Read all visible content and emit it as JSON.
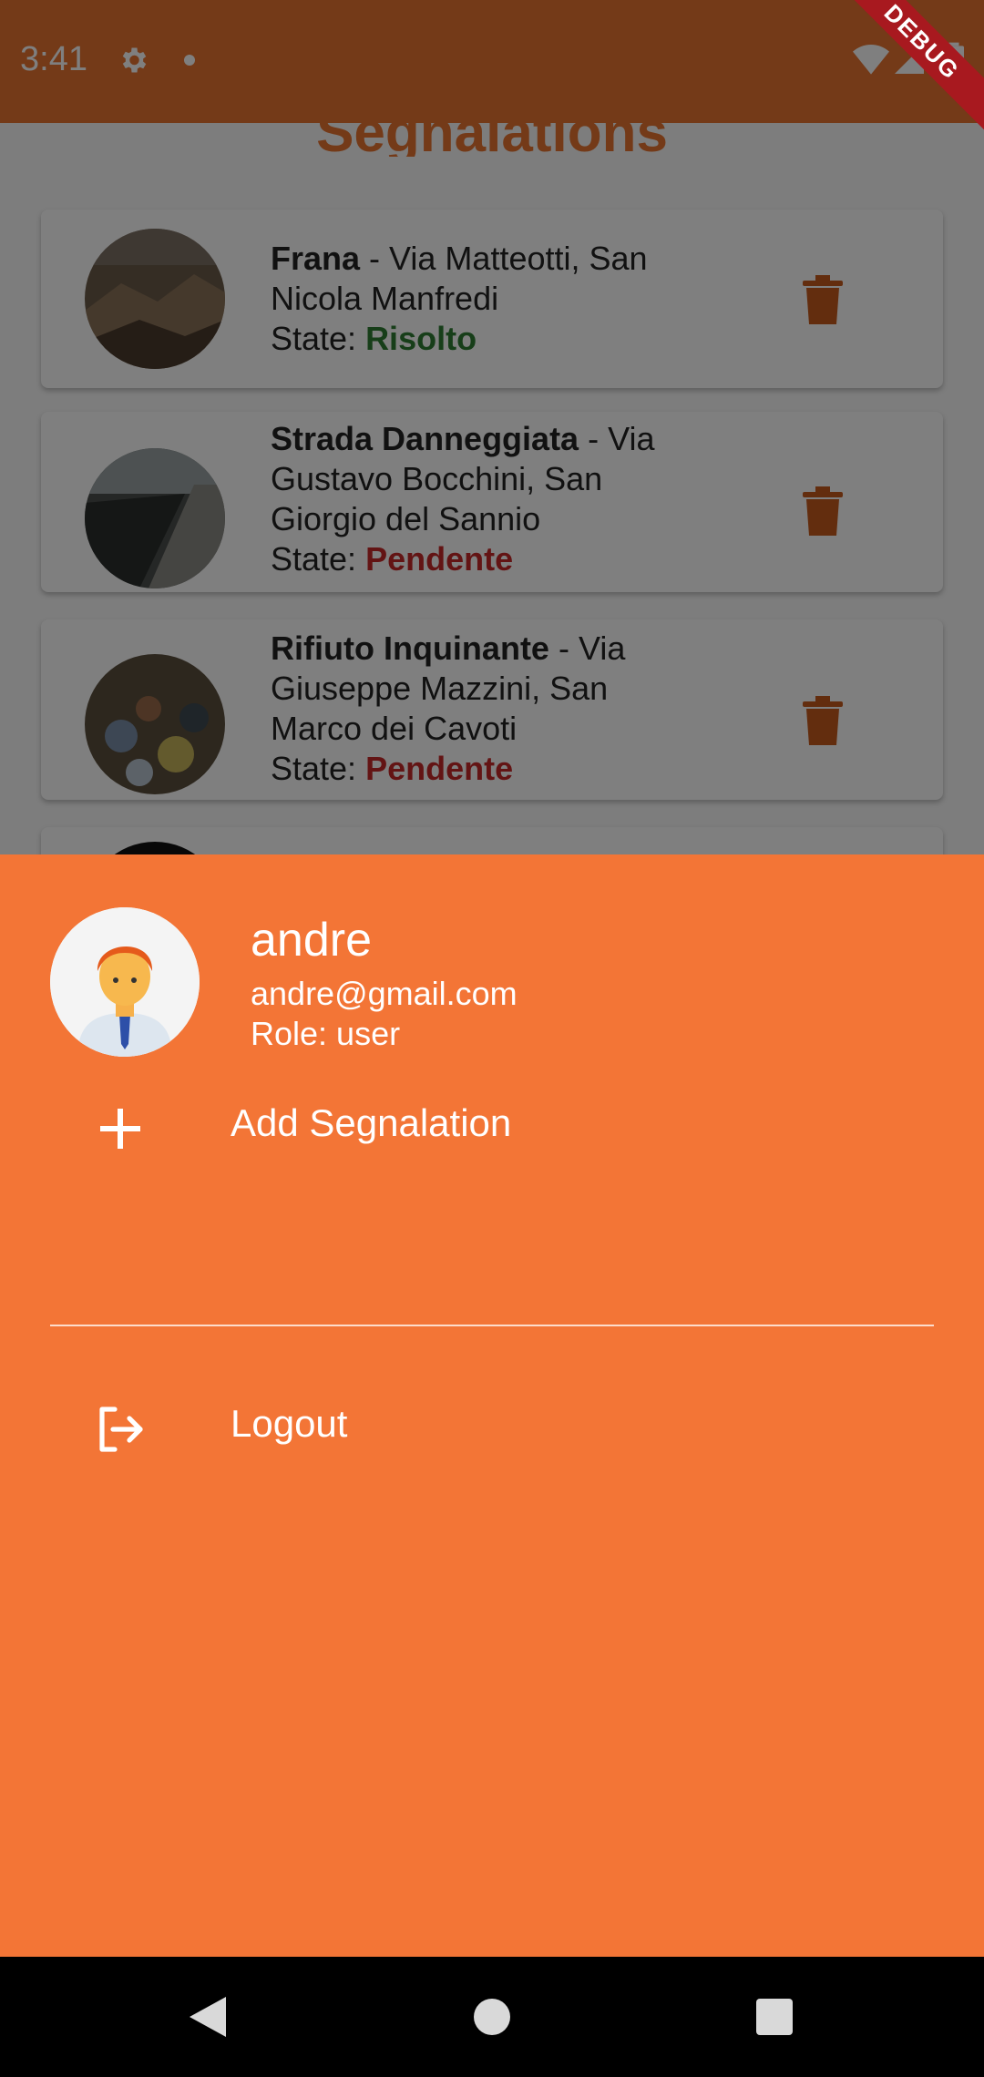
{
  "status_bar": {
    "time": "3:41"
  },
  "debug_banner": "DEBUG",
  "app": {
    "title": "Segnalations"
  },
  "segnalations": [
    {
      "type": "Frana",
      "sep": " - ",
      "address": "Via Matteotti, San Nicola Manfredi",
      "state_label": "State: ",
      "state": "Risolto",
      "state_color": "#2e7d32"
    },
    {
      "type": "Strada Danneggiata",
      "sep": " - ",
      "address": "Via Gustavo Bocchini, San Giorgio del Sannio",
      "state_label": "State: ",
      "state": "Pendente",
      "state_color": "#c62828"
    },
    {
      "type": "Rifiuto Inquinante",
      "sep": " - ",
      "address": "Via Giuseppe Mazzini, San Marco dei Cavoti",
      "state_label": "State: ",
      "state": "Pendente",
      "state_color": "#c62828"
    }
  ],
  "drawer": {
    "user": {
      "name": "andre",
      "email": "andre@gmail.com",
      "role": "Role: user"
    },
    "menu": [
      {
        "label": "Add Segnalation",
        "icon": "plus-icon"
      },
      {
        "label": "Logout",
        "icon": "logout-icon"
      }
    ],
    "background_color": "#f37536"
  },
  "colors": {
    "accent": "#e87431",
    "trash": "#c75a1c"
  }
}
